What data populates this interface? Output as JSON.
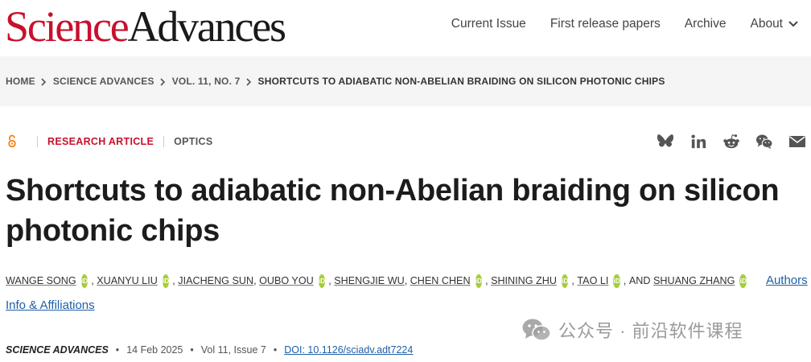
{
  "header": {
    "logo_science": "Science",
    "logo_advances": "Advances",
    "nav": [
      "Current Issue",
      "First release papers",
      "Archive",
      "About"
    ]
  },
  "breadcrumb": [
    "HOME",
    "SCIENCE ADVANCES",
    "VOL. 11, NO. 7",
    "SHORTCUTS TO ADIABATIC NON-ABELIAN BRAIDING ON SILICON PHOTONIC CHIPS"
  ],
  "article": {
    "type": "RESEARCH ARTICLE",
    "subject": "OPTICS",
    "title": "Shortcuts to adiabatic non-Abelian braiding on silicon photonic chips",
    "authors": [
      "WANGE SONG",
      "XUANYU LIU",
      "JIACHENG SUN",
      "OUBO YOU",
      "SHENGJIE WU",
      "CHEN CHEN",
      "SHINING ZHU",
      "TAO LI",
      "SHUANG ZHANG"
    ],
    "authors_link": "Authors",
    "info_link": "Info & Affiliations",
    "and_text": "AND",
    "orcid_label": "iD"
  },
  "citation": {
    "journal": "SCIENCE ADVANCES",
    "date": "14 Feb 2025",
    "volume": "Vol 11, Issue 7",
    "doi": "DOI: 10.1126/sciadv.adt7224"
  },
  "share_icons": [
    "bluesky-icon",
    "linkedin-icon",
    "reddit-icon",
    "wechat-icon",
    "email-icon"
  ],
  "watermark": "公众号 · 前沿软件课程",
  "colors": {
    "brand_red": "#c8102e",
    "link_blue": "#1f5fa6",
    "orcid_green": "#a6ce39"
  }
}
